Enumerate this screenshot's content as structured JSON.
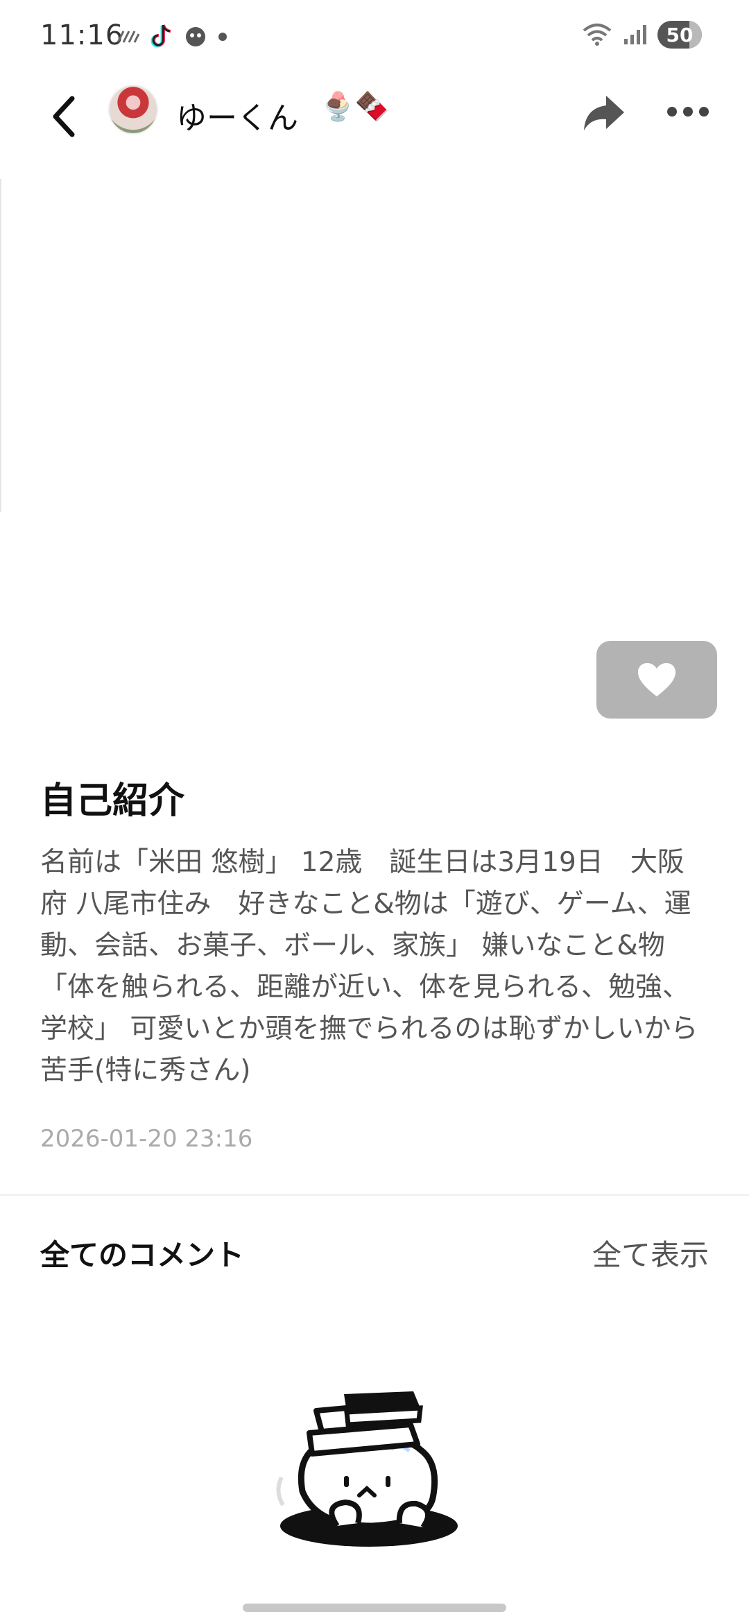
{
  "status_bar": {
    "time": "11:16",
    "battery": "50"
  },
  "header": {
    "username": "ゆーくん",
    "emoji_badges": "🍨🍫"
  },
  "intro": {
    "title": "自己紹介",
    "body": "名前は「米田 悠樹」 12歳　誕生日は3月19日　大阪府 八尾市住み　好きなこと&物は「遊び、ゲーム、運動、会話、お菓子、ボール、家族」 嫌いなこと&物「体を触られる、距離が近い、体を見られる、勉強、学校」 可愛いとか頭を撫でられるのは恥ずかしいから苦手(特に秀さん)",
    "date": "2026-01-20 23:16"
  },
  "comments": {
    "title": "全てのコメント",
    "show_all": "全て表示"
  },
  "colors": {
    "like_button_bg": "#b3b3b3",
    "text_primary": "#111111",
    "text_secondary": "#555555",
    "text_muted": "#aaaaaa"
  }
}
